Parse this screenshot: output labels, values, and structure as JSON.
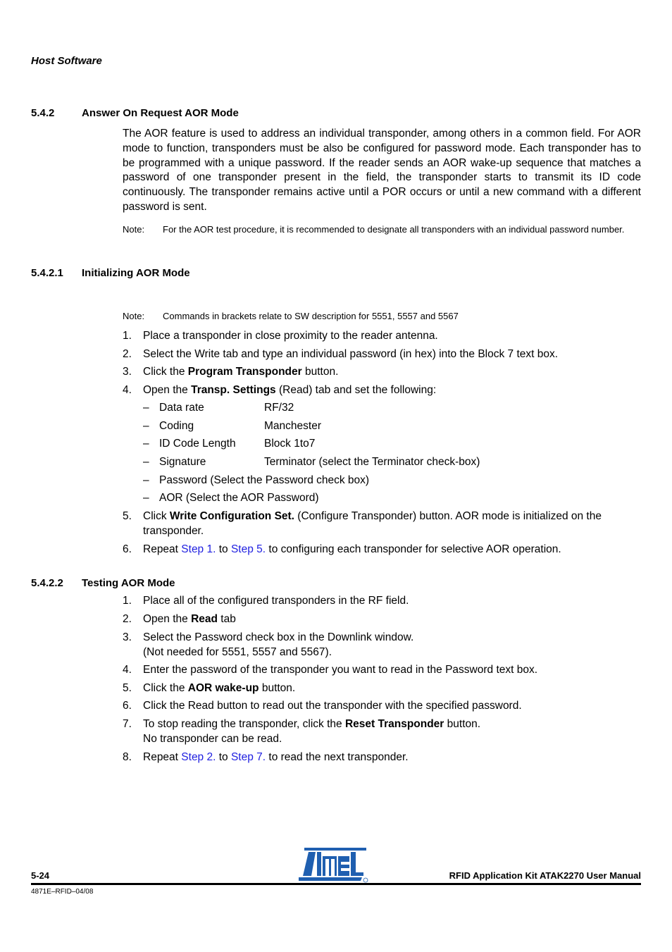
{
  "header": {
    "running_title": "Host Software"
  },
  "section_542": {
    "number": "5.4.2",
    "title": "Answer On Request AOR Mode",
    "body": "The AOR feature is used to address an individual transponder, among others in a common field. For AOR mode to function, transponders must be also be configured for password mode. Each transponder has to be programmed with a unique password. If the reader sends an AOR wake-up sequence that matches a password of one transponder present in the field, the transponder starts to transmit its ID code continuously. The transponder remains active until a POR occurs or until a new command with a different password is sent.",
    "note_label": "Note:",
    "note_text": "For the AOR test procedure, it is recommended to designate all transponders with an individual password number."
  },
  "section_5421": {
    "number": "5.4.2.1",
    "title": "Initializing AOR Mode",
    "note_label": "Note:",
    "note_text": "Commands in brackets relate to SW description for 5551, 5557 and 5567",
    "steps": [
      {
        "n": "1.",
        "pre": "Place a transponder in close proximity to the reader antenna."
      },
      {
        "n": "2.",
        "pre": "Select the Write tab and type an individual password (in hex) into the Block 7 text box."
      },
      {
        "n": "3.",
        "pre": "Click the ",
        "bold": "Program Transponder",
        "post": " button."
      },
      {
        "n": "4.",
        "pre": "Open the ",
        "bold": "Transp. Settings",
        "post": " (Read) tab and set the following:"
      },
      {
        "n": "5.",
        "pre": "Click ",
        "bold": "Write Configuration Set.",
        "post": " (Configure Transponder) button. AOR mode is initialized on the transponder."
      },
      {
        "n": "6.",
        "pre": "Repeat ",
        "link1": "Step 1.",
        "mid": " to ",
        "link2": "Step 5.",
        "post": " to configuring each transponder for selective AOR operation."
      }
    ],
    "settings": [
      {
        "key": "Data rate",
        "value": "RF/32"
      },
      {
        "key": "Coding",
        "value": "Manchester"
      },
      {
        "key": "ID Code Length",
        "value": "Block 1to7"
      },
      {
        "key": "Signature",
        "value": "Terminator (select the Terminator check-box)"
      },
      {
        "key": "Password (Select the Password check box)",
        "value": ""
      },
      {
        "key": "AOR (Select the AOR Password)",
        "value": ""
      }
    ],
    "dash": "–"
  },
  "section_5422": {
    "number": "5.4.2.2",
    "title": "Testing AOR Mode",
    "steps": [
      {
        "n": "1.",
        "pre": "Place all of the configured transponders in the RF field."
      },
      {
        "n": "2.",
        "pre": "Open the ",
        "bold": "Read",
        "post": " tab"
      },
      {
        "n": "3.",
        "pre": "Select the Password check box in the Downlink window.",
        "line2": "(Not needed for 5551, 5557 and 5567)."
      },
      {
        "n": "4.",
        "pre": "Enter the password of the transponder you want to read in the Password text box."
      },
      {
        "n": "5.",
        "pre": "Click the ",
        "bold": "AOR wake-up",
        "post": " button."
      },
      {
        "n": "6.",
        "pre": "Click the Read button to read out the transponder with the specified password."
      },
      {
        "n": "7.",
        "pre": "To stop reading the transponder, click the ",
        "bold": "Reset Transponder",
        "post": " button.",
        "line2": "No transponder can be read."
      },
      {
        "n": "8.",
        "pre": "Repeat ",
        "link1": "Step 2.",
        "mid": " to ",
        "link2": "Step 7.",
        "post": " to read the next transponder."
      }
    ]
  },
  "footer": {
    "page_number": "5-24",
    "doc_title": "RFID Application Kit ATAK2270 User Manual",
    "doc_code": "4871E–RFID–04/08",
    "logo_text": "ATMEL",
    "logo_color": "#1f5fb0"
  }
}
